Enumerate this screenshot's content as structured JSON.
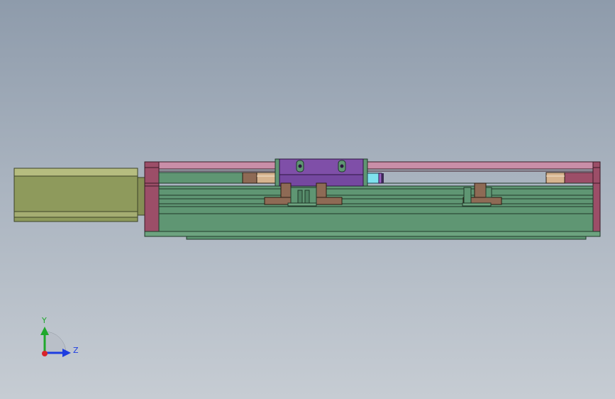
{
  "viewport": {
    "colors": {
      "bg_top": "#8e9bab",
      "bg_bottom": "#c6ccd3",
      "motor": "#8e9a5c",
      "end_plate": "#9c4e68",
      "top_rail": "#c98ea8",
      "body": "#5f9673",
      "carriage": "#7f4fa8",
      "bracket": "#8e6a55",
      "copper": "#d7b48f",
      "cyan": "#7fe2ee"
    },
    "components": [
      "motor",
      "left-end-plate",
      "right-end-plate",
      "top-guide-rail",
      "linear-body",
      "carriage-block",
      "slider-bracket",
      "stop-bracket",
      "bearing-sleeve",
      "sensor-block"
    ]
  },
  "triad": {
    "y_label": "Y",
    "z_label": "Z",
    "colors": {
      "y": "#1fa82c",
      "z": "#1e3de0",
      "x": "#d8232a",
      "quadrant": "#b9bfc8"
    }
  }
}
